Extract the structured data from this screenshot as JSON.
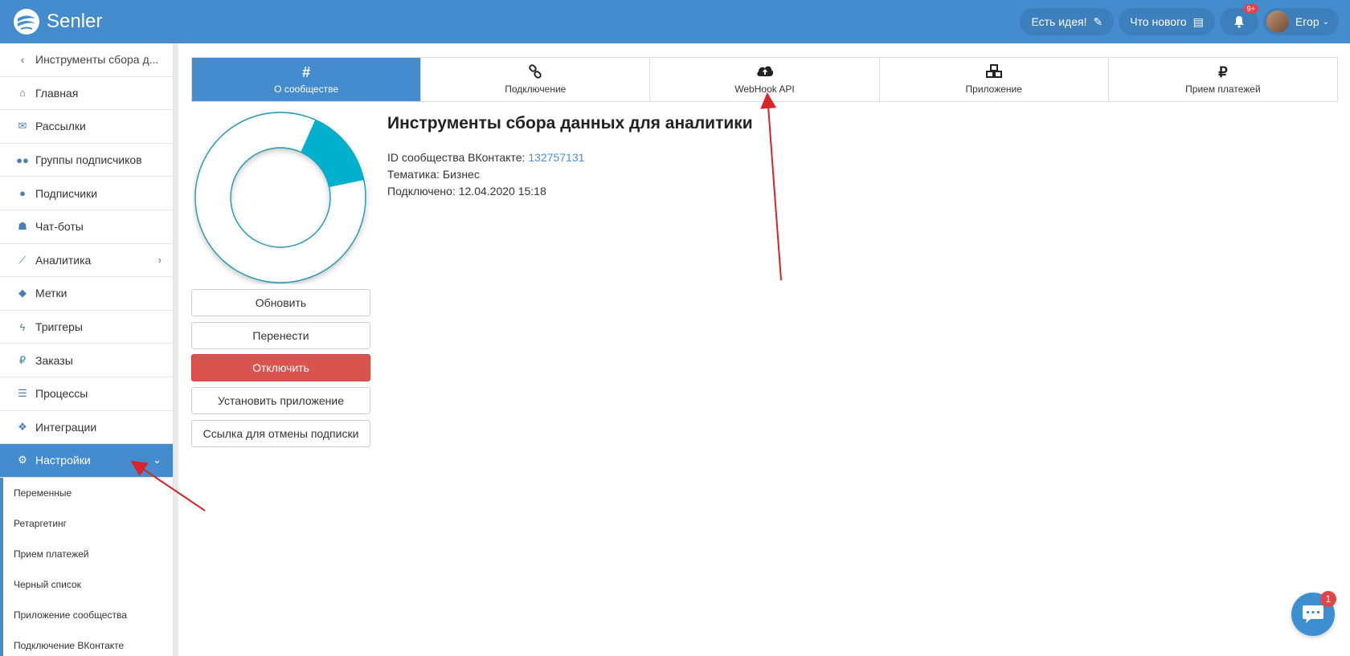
{
  "app": {
    "name": "Senler"
  },
  "header": {
    "idea_label": "Есть идея!",
    "news_label": "Что нового",
    "notifications_badge": "9+",
    "user_name": "Егор"
  },
  "sidebar": {
    "back_label": "Инструменты сбора д...",
    "items": [
      {
        "label": "Главная",
        "icon": "home-icon"
      },
      {
        "label": "Рассылки",
        "icon": "envelope-icon"
      },
      {
        "label": "Группы подписчиков",
        "icon": "users-icon"
      },
      {
        "label": "Подписчики",
        "icon": "user-icon"
      },
      {
        "label": "Чат-боты",
        "icon": "android-icon"
      },
      {
        "label": "Аналитика",
        "icon": "chart-line-icon"
      },
      {
        "label": "Метки",
        "icon": "tag-icon"
      },
      {
        "label": "Триггеры",
        "icon": "bolt-icon"
      },
      {
        "label": "Заказы",
        "icon": "ruble-icon"
      },
      {
        "label": "Процессы",
        "icon": "server-icon"
      },
      {
        "label": "Интеграции",
        "icon": "cubes-icon"
      },
      {
        "label": "Настройки",
        "icon": "gears-icon"
      }
    ],
    "submenu": [
      "Переменные",
      "Ретаргетинг",
      "Прием платежей",
      "Черный список",
      "Приложение сообщества",
      "Подключение ВКонтакте"
    ]
  },
  "tabs": [
    {
      "label": "О сообществе",
      "icon": "hashtag-icon",
      "active": true
    },
    {
      "label": "Подключение",
      "icon": "link-icon",
      "active": false
    },
    {
      "label": "WebHook API",
      "icon": "cloud-upload-icon",
      "active": false
    },
    {
      "label": "Приложение",
      "icon": "cubes-icon",
      "active": false
    },
    {
      "label": "Прием платежей",
      "icon": "ruble-icon",
      "active": false
    }
  ],
  "actions": {
    "refresh": "Обновить",
    "move": "Перенести",
    "disconnect": "Отключить",
    "install_app": "Установить приложение",
    "unsubscribe_link": "Ссылка для отмены подписки"
  },
  "community": {
    "title": "Инструменты сбора данных для аналитики",
    "id_label": "ID сообщества ВКонтакте:",
    "id_value": "132757131",
    "theme_label": "Тематика:",
    "theme_value": "Бизнес",
    "connected_label": "Подключено:",
    "connected_value": "12.04.2020 15:18",
    "donut_fill_fraction": 0.15
  },
  "chat": {
    "badge": "1"
  },
  "colors": {
    "primary": "#448ccd",
    "danger": "#d9534f",
    "donut_accent": "#00b0cc",
    "annotation_arrow": "#d9232b"
  }
}
